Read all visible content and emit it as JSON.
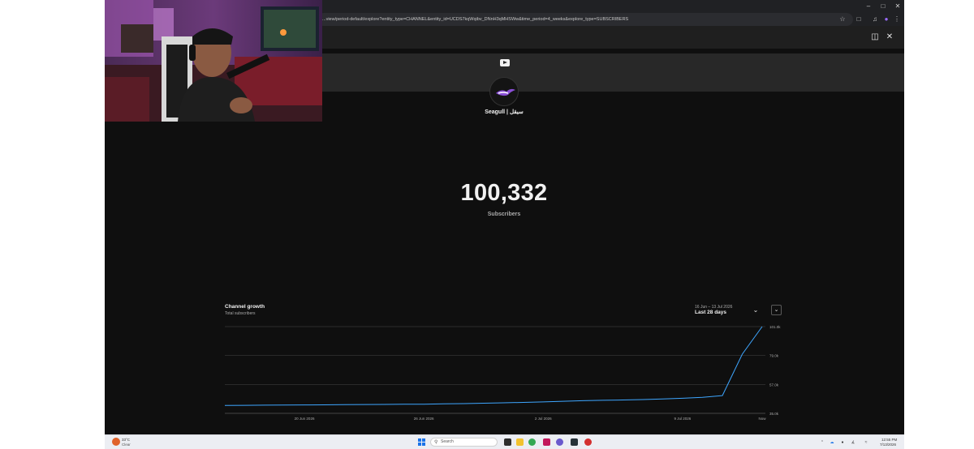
{
  "browser": {
    "url": "...view/period-default/explore?entity_type=CHANNEL&entity_id=UCDS7kqWqibv_DNnH3qMHSWw&time_period=4_weeks&explore_type=SUBSCRIBERS"
  },
  "channel": {
    "name": "Seagull | سيقل",
    "subscriber_count": "100,332",
    "subscriber_label": "Subscribers"
  },
  "chart": {
    "title": "Channel growth",
    "subtitle": "Total subscribers",
    "period_range": "16 Jun – 13 Jul 2026",
    "period_label": "Last 28 days"
  },
  "chart_data": {
    "type": "line",
    "title": "Channel growth",
    "subtitle": "Total subscribers",
    "x_ticks": [
      "20 Jun 2026",
      "26 Jun 2026",
      "2 Jul 2026",
      "9 Jul 2026",
      "Now"
    ],
    "y_ticks": [
      "101.0k",
      "79.0k",
      "57.0k",
      "35.0k"
    ],
    "ylim": [
      35000,
      101000
    ],
    "grid": true,
    "series": [
      {
        "color": "#3ea6ff",
        "x": [
          "16 Jun",
          "17 Jun",
          "18 Jun",
          "19 Jun",
          "20 Jun",
          "21 Jun",
          "22 Jun",
          "23 Jun",
          "24 Jun",
          "25 Jun",
          "26 Jun",
          "27 Jun",
          "28 Jun",
          "29 Jun",
          "30 Jun",
          "1 Jul",
          "2 Jul",
          "3 Jul",
          "4 Jul",
          "5 Jul",
          "6 Jul",
          "7 Jul",
          "8 Jul",
          "9 Jul",
          "10 Jul",
          "11 Jul",
          "12 Jul",
          "13 Jul"
        ],
        "values": [
          41000,
          41100,
          41200,
          41300,
          41400,
          41500,
          41600,
          41700,
          41800,
          41900,
          42000,
          42200,
          42400,
          42700,
          43000,
          43300,
          43700,
          44200,
          44600,
          44900,
          45200,
          45500,
          45900,
          46500,
          47200,
          48500,
          80000,
          101000
        ]
      }
    ]
  },
  "taskbar": {
    "weather_temp": "33°C",
    "weather_condition": "Clear",
    "search_placeholder": "Search",
    "clock_time": "12:55 PM",
    "clock_date": "7/13/2026"
  },
  "colors": {
    "background": "#0f0f0f",
    "line": "#3ea6ff",
    "grid": "#3a3a3a"
  }
}
